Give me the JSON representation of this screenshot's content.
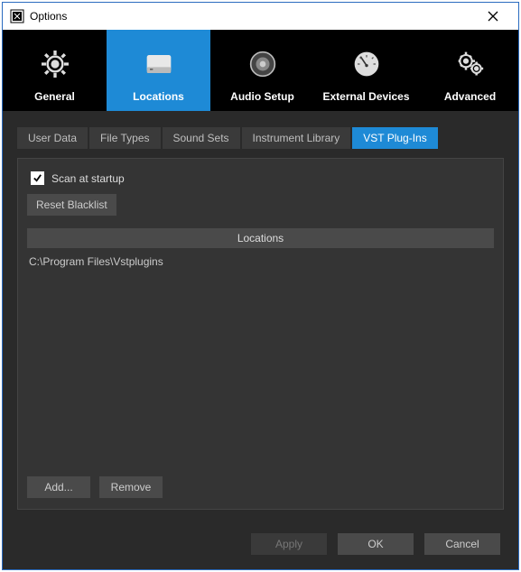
{
  "window": {
    "title": "Options"
  },
  "mainTabs": {
    "general": "General",
    "locations": "Locations",
    "audio": "Audio Setup",
    "external": "External Devices",
    "advanced": "Advanced"
  },
  "subTabs": {
    "userData": "User Data",
    "fileTypes": "File Types",
    "soundSets": "Sound Sets",
    "instLib": "Instrument Library",
    "vst": "VST Plug-Ins"
  },
  "vstPanel": {
    "scanLabel": "Scan at startup",
    "resetBlacklist": "Reset Blacklist",
    "locationsHeader": "Locations",
    "paths": [
      "C:\\Program Files\\Vstplugins"
    ],
    "addBtn": "Add...",
    "removeBtn": "Remove"
  },
  "dialog": {
    "apply": "Apply",
    "ok": "OK",
    "cancel": "Cancel"
  }
}
